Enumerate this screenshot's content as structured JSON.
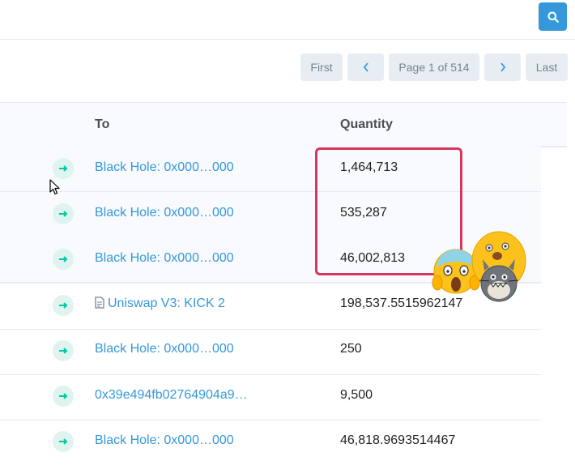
{
  "pagination": {
    "first_label": "First",
    "prev_icon": "chevron-left-icon",
    "page_label": "Page 1 of 514",
    "next_icon": "chevron-right-icon",
    "last_label": "Last"
  },
  "search": {
    "icon": "search-icon"
  },
  "table": {
    "headers": {
      "to": "To",
      "quantity": "Quantity"
    },
    "rows": [
      {
        "to": "Black Hole: 0x000…000",
        "quantity": "1,464,713",
        "highlight": true
      },
      {
        "to": "Black Hole: 0x000…000",
        "quantity": "535,287",
        "highlight": true
      },
      {
        "to": "Black Hole: 0x000…000",
        "quantity": "46,002,813",
        "highlight": true
      },
      {
        "to": "Uniswap V3: KICK 2",
        "quantity": "198,537.5515962147",
        "contract": true
      },
      {
        "to": "Black Hole: 0x000…000",
        "quantity": "250"
      },
      {
        "to": "0x39e494fb02764904a9…",
        "quantity": "9,500"
      },
      {
        "to": "Black Hole: 0x000…000",
        "quantity": "46,818.9693514467"
      }
    ]
  },
  "colors": {
    "accent": "#3498db",
    "highlight": "#ffff00",
    "annotation_box": "#d9365e",
    "transfer_badge": "#dff4ee"
  }
}
